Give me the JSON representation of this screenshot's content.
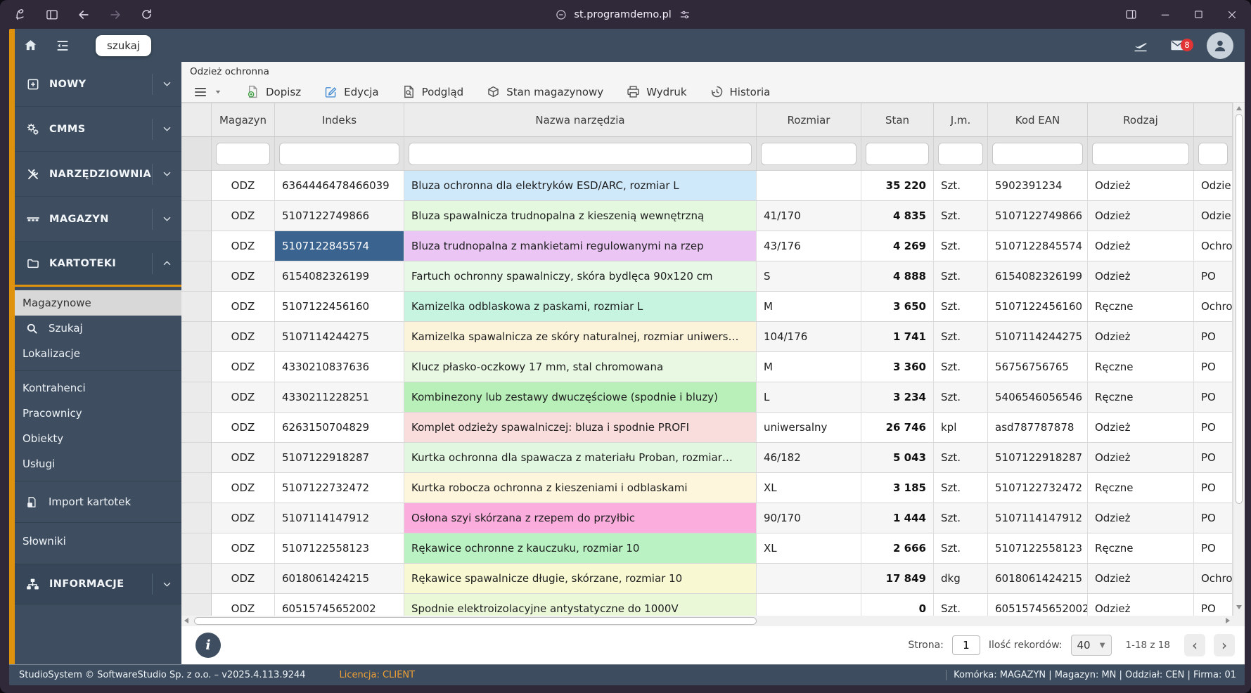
{
  "colors": {
    "accent_orange": "#df920e",
    "selected_cell": "#3a6390",
    "badge_red": "#e23434",
    "active_item_bg": "#d8d8d8"
  },
  "browser": {
    "url": "st.programdemo.pl"
  },
  "app_header": {
    "search_chip": "szukaj",
    "mail_badge": "8"
  },
  "sidebar": {
    "top_items": [
      {
        "id": "nowy",
        "label": "NOWY",
        "icon": "plus-square-icon"
      },
      {
        "id": "cmms",
        "label": "CMMS",
        "icon": "gears-icon"
      },
      {
        "id": "narzedziownia",
        "label": "NARZĘDZIOWNIA",
        "icon": "tools-icon"
      },
      {
        "id": "magazyn",
        "label": "MAGAZYN",
        "icon": "pallet-icon"
      },
      {
        "id": "kartoteki",
        "label": "KARTOTEKI",
        "icon": "folder-icon",
        "expanded": true
      }
    ],
    "kartoteki_submenu": [
      {
        "items": [
          {
            "id": "magazynowe",
            "label": "Magazynowe",
            "active": true
          },
          {
            "id": "szukaj",
            "label": "Szukaj",
            "icon": "search-icon"
          },
          {
            "id": "lokalizacje",
            "label": "Lokalizacje"
          }
        ]
      },
      {
        "items": [
          {
            "id": "kontrahenci",
            "label": "Kontrahenci"
          },
          {
            "id": "pracownicy",
            "label": "Pracownicy"
          },
          {
            "id": "obiekty",
            "label": "Obiekty"
          },
          {
            "id": "uslugi",
            "label": "Usługi"
          }
        ]
      },
      {
        "items": [
          {
            "id": "import-kartotek",
            "label": "Import kartotek",
            "icon": "excel-file-icon"
          }
        ]
      },
      {
        "items": [
          {
            "id": "slowniki",
            "label": "Słowniki"
          }
        ]
      }
    ],
    "bottom_item": {
      "id": "informacje",
      "label": "INFORMACJE",
      "icon": "sitemap-icon"
    }
  },
  "main": {
    "title": "Odzież ochronna",
    "toolbar": {
      "buttons": [
        {
          "id": "dopisz",
          "label": "Dopisz",
          "icon": "add-file-icon"
        },
        {
          "id": "edycja",
          "label": "Edycja",
          "icon": "edit-icon"
        },
        {
          "id": "podglad",
          "label": "Podgląd",
          "icon": "preview-icon"
        },
        {
          "id": "stan-magazynowy",
          "label": "Stan magazynowy",
          "icon": "package-icon"
        },
        {
          "id": "wydruk",
          "label": "Wydruk",
          "icon": "printer-icon"
        },
        {
          "id": "historia",
          "label": "Historia",
          "icon": "history-icon"
        }
      ]
    },
    "table": {
      "columns": [
        {
          "id": "magazyn",
          "label": "Magazyn"
        },
        {
          "id": "indeks",
          "label": "Indeks"
        },
        {
          "id": "nazwa",
          "label": "Nazwa narzędzia"
        },
        {
          "id": "rozmiar",
          "label": "Rozmiar"
        },
        {
          "id": "stan",
          "label": "Stan"
        },
        {
          "id": "jm",
          "label": "J.m."
        },
        {
          "id": "ean",
          "label": "Kod EAN"
        },
        {
          "id": "rodzaj",
          "label": "Rodzaj"
        },
        {
          "id": "extra",
          "label": ""
        }
      ],
      "rows": [
        {
          "magazyn": "ODZ",
          "indeks": "6364446478466039",
          "nazwa": "Bluza ochronna dla elektryków ESD/ARC, rozmiar L",
          "nazwa_bg": "#cfe9fa",
          "rozmiar": "",
          "stan": "35 220",
          "jm": "Szt.",
          "ean": "5902391234",
          "rodzaj": "Odzież",
          "extra": "Odzie"
        },
        {
          "magazyn": "ODZ",
          "indeks": "5107122749866",
          "nazwa": "Bluza spawalnicza trudnopalna z kieszenią wewnętrzną",
          "nazwa_bg": "#e4f8df",
          "rozmiar": "41/170",
          "stan": "4 835",
          "jm": "Szt.",
          "ean": "5107122749866",
          "rodzaj": "Odzież",
          "extra": "Odzie"
        },
        {
          "magazyn": "ODZ",
          "indeks": "5107122845574",
          "nazwa": "Bluza trudnopalna z mankietami regulowanymi na rzep",
          "nazwa_bg": "#ebc6f5",
          "rozmiar": "43/176",
          "stan": "4 269",
          "jm": "Szt.",
          "ean": "5107122845574",
          "rodzaj": "Odzież",
          "extra": "Ochro",
          "selected": true
        },
        {
          "magazyn": "ODZ",
          "indeks": "6154082326199",
          "nazwa": "Fartuch ochronny spawalniczy, skóra bydlęca 90x120 cm",
          "nazwa_bg": "#e7f8e7",
          "rozmiar": "S",
          "stan": "4 888",
          "jm": "Szt.",
          "ean": "6154082326199",
          "rodzaj": "Odzież",
          "extra": "PO"
        },
        {
          "magazyn": "ODZ",
          "indeks": "5107122456160",
          "nazwa": "Kamizelka odblaskowa z paskami, rozmiar L",
          "nazwa_bg": "#c6f4e0",
          "rozmiar": "M",
          "stan": "3 650",
          "jm": "Szt.",
          "ean": "5107122456160",
          "rodzaj": "Ręczne",
          "extra": "Ochro"
        },
        {
          "magazyn": "ODZ",
          "indeks": "5107114244275",
          "nazwa": "Kamizelka spawalnicza ze skóry naturalnej, rozmiar uniwers…",
          "nazwa_bg": "#fcf4da",
          "rozmiar": "104/176",
          "stan": "1 741",
          "jm": "Szt.",
          "ean": "5107114244275",
          "rodzaj": "Odzież",
          "extra": "PO"
        },
        {
          "magazyn": "ODZ",
          "indeks": "4330210837636",
          "nazwa": "Klucz płasko-oczkowy 17 mm, stal chromowana",
          "nazwa_bg": "#e9f8e3",
          "rozmiar": "M",
          "stan": "3 360",
          "jm": "Szt.",
          "ean": "56756756765",
          "rodzaj": "Ręczne",
          "extra": "PO"
        },
        {
          "magazyn": "ODZ",
          "indeks": "4330211228251",
          "nazwa": "Kombinezony lub zestawy dwuczęściowe (spodnie i bluzy)",
          "nazwa_bg": "#b9efb9",
          "rozmiar": "L",
          "stan": "3 234",
          "jm": "Szt.",
          "ean": "5406546056546",
          "rodzaj": "Ręczne",
          "extra": "PO"
        },
        {
          "magazyn": "ODZ",
          "indeks": "6263150704829",
          "nazwa": "Komplet odzieży spawalniczej: bluza i spodnie PROFI",
          "nazwa_bg": "#f9dcdc",
          "rozmiar": "uniwersalny",
          "stan": "26 746",
          "jm": "kpl",
          "ean": "asd787787878",
          "rodzaj": "Odzież",
          "extra": "PO"
        },
        {
          "magazyn": "ODZ",
          "indeks": "5107122918287",
          "nazwa": "Kurtka ochronna dla spawacza z materiału Proban, rozmiar…",
          "nazwa_bg": "#e2f7e0",
          "rozmiar": "46/182",
          "stan": "5 043",
          "jm": "Szt.",
          "ean": "5107122918287",
          "rodzaj": "Odzież",
          "extra": "PO"
        },
        {
          "magazyn": "ODZ",
          "indeks": "5107122732472",
          "nazwa": "Kurtka robocza ochronna z kieszeniami i odblaskami",
          "nazwa_bg": "#fdf6dc",
          "rozmiar": "XL",
          "stan": "3 185",
          "jm": "Szt.",
          "ean": "5107122732472",
          "rodzaj": "Ręczne",
          "extra": "PO"
        },
        {
          "magazyn": "ODZ",
          "indeks": "5107114147912",
          "nazwa": "Osłona szyi skórzana z rzepem do przyłbic",
          "nazwa_bg": "#fbaede",
          "rozmiar": "90/170",
          "stan": "1 444",
          "jm": "Szt.",
          "ean": "5107114147912",
          "rodzaj": "Odzież",
          "extra": "PO"
        },
        {
          "magazyn": "ODZ",
          "indeks": "5107122558123",
          "nazwa": "Rękawice ochronne z kauczuku, rozmiar 10",
          "nazwa_bg": "#baf2c4",
          "rozmiar": "XL",
          "stan": "2 666",
          "jm": "Szt.",
          "ean": "5107122558123",
          "rodzaj": "Ręczne",
          "extra": "PO"
        },
        {
          "magazyn": "ODZ",
          "indeks": "6018061424215",
          "nazwa": "Rękawice spawalnicze długie, skórzane, rozmiar 10",
          "nazwa_bg": "#f8f9d2",
          "rozmiar": "",
          "stan": "17 849",
          "jm": "dkg",
          "ean": "6018061424215",
          "rodzaj": "Odzież",
          "extra": "Ochro"
        },
        {
          "magazyn": "ODZ",
          "indeks": "60515745652002",
          "nazwa": "Spodnie elektroizolacyjne antystatyczne do 1000V",
          "nazwa_bg": "#eaf8d8",
          "rozmiar": "",
          "stan": "0",
          "jm": "Szt.",
          "ean": "60515745652002",
          "rodzaj": "Odzież",
          "extra": "PO"
        }
      ]
    },
    "pagination": {
      "page_label": "Strona:",
      "page_value": "1",
      "records_label": "Ilość rekordów:",
      "records_value": "40",
      "range": "1-18 z 18"
    }
  },
  "footer": {
    "left": "StudioSystem © SoftwareStudio Sp. z o.o. – v2025.4.113.9244",
    "license_label": "Licencja:",
    "license_value": "CLIENT",
    "right": "Komórka: MAGAZYN | Magazyn: MN | Oddział: CEN | Firma: 01"
  }
}
